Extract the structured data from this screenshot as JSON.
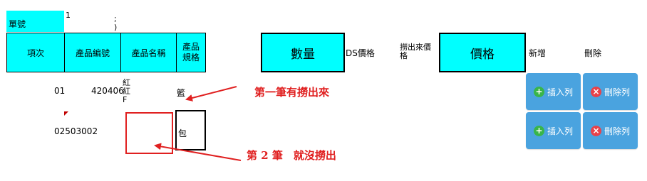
{
  "header": {
    "order_no_label": "單號",
    "order_no_value": "1",
    "order_no_suffix": ";\n)"
  },
  "columns": {
    "item": "項次",
    "product_code": "產品編號",
    "product_name": "產品名稱",
    "product_spec": "產品\n規格",
    "quantity": "數量",
    "ds_price": "DS價格",
    "fetched_price": "撈出來價\n格",
    "price": "價格",
    "add": "新增",
    "delete": "刪除"
  },
  "rows": [
    {
      "item": "01",
      "product_code": "420406",
      "product_name": "紅\n紅\nF",
      "product_spec": "籃",
      "insert_label": "插入列",
      "delete_label": "刪除列"
    },
    {
      "item": "02503002",
      "product_code": "",
      "product_name": "",
      "product_spec": "包",
      "insert_label": "插入列",
      "delete_label": "刪除列"
    }
  ],
  "annotations": {
    "first": "第一筆有撈出來",
    "second": "第 2 筆　就沒撈出"
  },
  "colors": {
    "header_fill": "#00ffff",
    "button_fill": "#4aa3df",
    "annotation": "#e02020",
    "plus_icon": "#39b54a",
    "delete_icon": "#e8424a"
  }
}
